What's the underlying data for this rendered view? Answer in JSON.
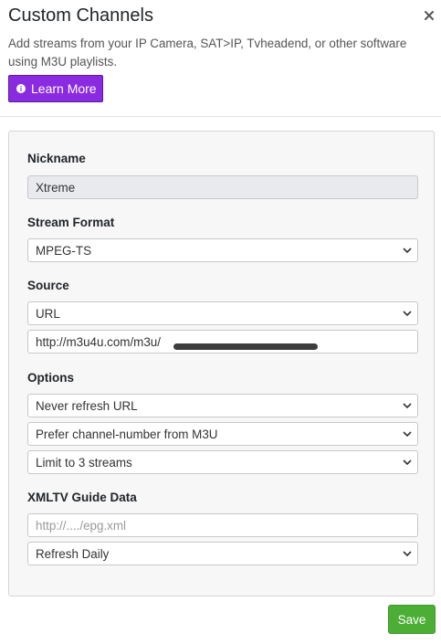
{
  "dialog": {
    "title": "Custom Channels",
    "description": "Add streams from your IP Camera, SAT>IP, Tvheadend, or other software using M3U playlists.",
    "learn_more_label": "Learn More",
    "close_icon": "close-icon"
  },
  "form": {
    "nickname": {
      "label": "Nickname",
      "value": "Xtreme"
    },
    "stream_format": {
      "label": "Stream Format",
      "selected": "MPEG-TS"
    },
    "source": {
      "label": "Source",
      "type_selected": "URL",
      "url_value": "http://m3u4u.com/m3u/"
    },
    "options": {
      "label": "Options",
      "refresh_selected": "Never refresh URL",
      "channel_number_selected": "Prefer channel-number from M3U",
      "limit_selected": "Limit to 3 streams"
    },
    "xmltv": {
      "label": "XMLTV Guide Data",
      "url_placeholder": "http://..../epg.xml",
      "refresh_selected": "Refresh Daily"
    }
  },
  "actions": {
    "save_label": "Save"
  },
  "colors": {
    "learn_more_bg": "#8a2be2",
    "save_bg": "#4cae34",
    "panel_bg": "#f7f7f8"
  }
}
